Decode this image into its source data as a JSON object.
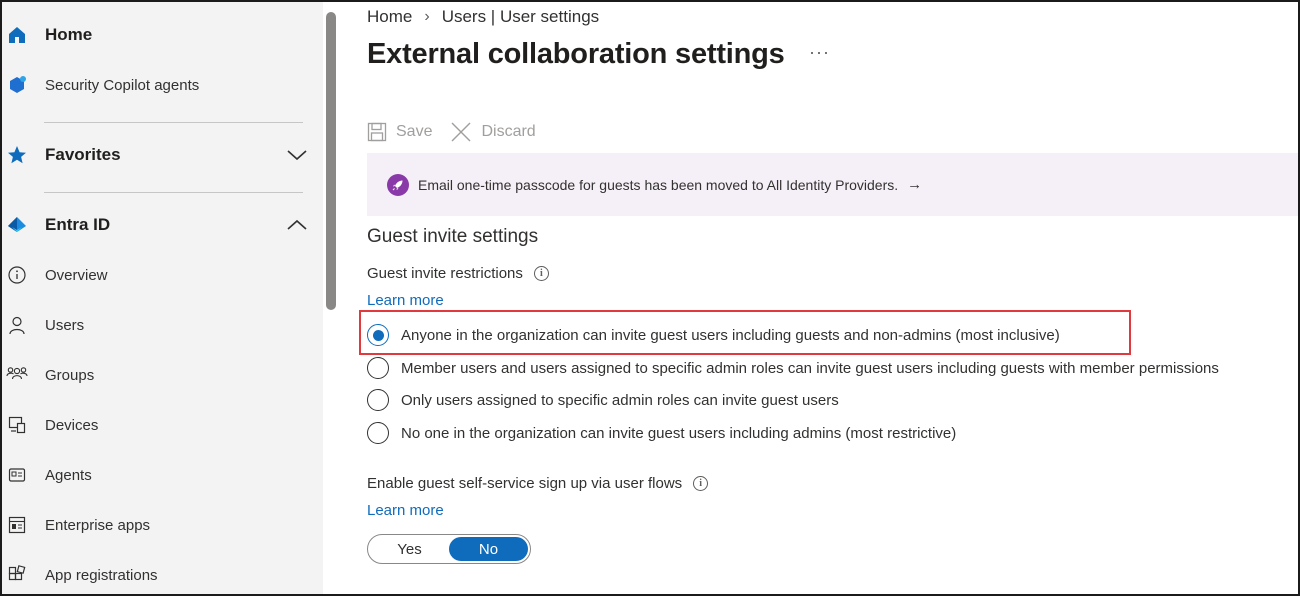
{
  "sidebar": {
    "items": [
      {
        "label": "Home",
        "icon": "home-icon"
      },
      {
        "label": "Security Copilot agents",
        "icon": "copilot-icon"
      },
      {
        "label": "Favorites",
        "icon": "star-icon"
      },
      {
        "label": "Entra ID",
        "icon": "entra-icon"
      },
      {
        "label": "Overview",
        "icon": "info-icon"
      },
      {
        "label": "Users",
        "icon": "user-icon"
      },
      {
        "label": "Groups",
        "icon": "groups-icon"
      },
      {
        "label": "Devices",
        "icon": "devices-icon"
      },
      {
        "label": "Agents",
        "icon": "agents-icon"
      },
      {
        "label": "Enterprise apps",
        "icon": "enterprise-apps-icon"
      },
      {
        "label": "App registrations",
        "icon": "app-registrations-icon"
      }
    ]
  },
  "breadcrumb": {
    "home": "Home",
    "sep": "›",
    "current": "Users | User settings"
  },
  "page": {
    "title": "External collaboration settings",
    "more": "···"
  },
  "toolbar": {
    "save_label": "Save",
    "discard_label": "Discard"
  },
  "banner": {
    "text": "Email one-time passcode for guests has been moved to All Identity Providers.",
    "arrow": "→"
  },
  "guest_invite": {
    "section_title": "Guest invite settings",
    "restrictions_label": "Guest invite restrictions",
    "learn_more": "Learn more",
    "options": [
      {
        "label": "Anyone in the organization can invite guest users including guests and non-admins (most inclusive)",
        "selected": true
      },
      {
        "label": "Member users and users assigned to specific admin roles can invite guest users including guests with member permissions",
        "selected": false
      },
      {
        "label": "Only users assigned to specific admin roles can invite guest users",
        "selected": false
      },
      {
        "label": "No one in the organization can invite guest users including admins (most restrictive)",
        "selected": false
      }
    ]
  },
  "self_service": {
    "label": "Enable guest self-service sign up via user flows",
    "learn_more": "Learn more",
    "toggle": {
      "yes": "Yes",
      "no": "No",
      "selected": "No"
    }
  },
  "colors": {
    "accent": "#0f6cbd",
    "highlight_border": "#e0393e",
    "banner_bg": "#f5f0f7",
    "banner_icon": "#8a3aa8"
  }
}
